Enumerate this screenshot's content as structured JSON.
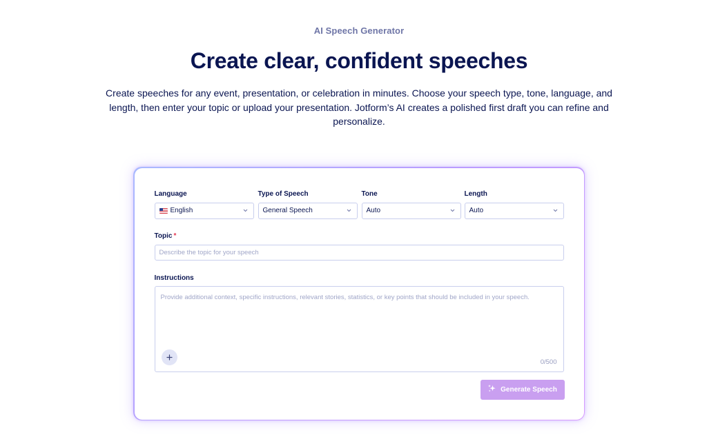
{
  "hero": {
    "eyebrow": "AI Speech Generator",
    "title": "Create clear, confident speeches",
    "description": "Create speeches for any event, presentation, or celebration in minutes. Choose your speech type, tone, language, and length, then enter your topic or upload your presentation. Jotform’s AI creates a polished first draft you can refine and personalize."
  },
  "form": {
    "language": {
      "label": "Language",
      "value": "English",
      "flag_icon": "us-flag-icon"
    },
    "speech_type": {
      "label": "Type of Speech",
      "value": "General Speech"
    },
    "tone": {
      "label": "Tone",
      "value": "Auto"
    },
    "length": {
      "label": "Length",
      "value": "Auto"
    },
    "topic": {
      "label": "Topic",
      "required_mark": "*",
      "value": "",
      "placeholder": "Describe the topic for your speech"
    },
    "instructions": {
      "label": "Instructions",
      "value": "",
      "placeholder": "Provide additional context, specific instructions, relevant stories, statistics, or key points that should be included in your speech.",
      "attach_icon": "plus-icon",
      "counter": "0/500"
    },
    "generate_button": {
      "label": "Generate Speech",
      "icon": "sparkles-icon"
    }
  },
  "colors": {
    "title": "#0a1551",
    "eyebrow": "#6f76a7",
    "button_disabled": "#c99ff0",
    "card_gradient_start": "#a9b9ff",
    "card_gradient_end": "#d79bff",
    "required": "#e2344e"
  }
}
